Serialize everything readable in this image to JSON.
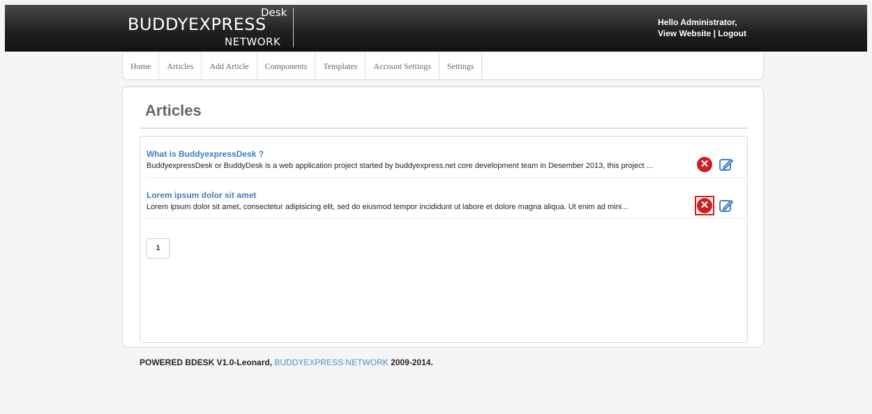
{
  "logo": {
    "desk": "Desk",
    "main": "BUDDYEXPRESS",
    "network": "NETWORK"
  },
  "user": {
    "greeting": "Hello Administrator,",
    "view_website": "View Website",
    "separator": " | ",
    "logout": "Logout"
  },
  "nav": [
    "Home",
    "Articles",
    "Add Article",
    "Components",
    "Templates",
    "Account Settings",
    "Settings"
  ],
  "page": {
    "title": "Articles"
  },
  "articles": [
    {
      "title": "What is BuddyexpressDesk ?",
      "excerpt": "BuddyexpressDesk or BuddyDesk is a web application project started by buddyexpress.net core development team in Desember 2013, this project ..."
    },
    {
      "title": "Lorem ipsum dolor sit amet",
      "excerpt": "Lorem ipsum dolor sit amet, consectetur adipisicing elit, sed do eiusmod tempor incididunt ut labore et dolore magna aliqua. Ut enim ad mini..."
    }
  ],
  "pagination": {
    "current": "1"
  },
  "footer": {
    "prefix": "POWERED BDESK V1.0-Leonard, ",
    "link": "BUDDYEXPRESS NETWORK",
    "suffix": " 2009-2014."
  },
  "icons": {
    "delete": "delete-icon",
    "edit": "edit-icon"
  },
  "colors": {
    "accent": "#3a7fc1",
    "delete": "#cc2026",
    "highlight": "#e01616"
  }
}
